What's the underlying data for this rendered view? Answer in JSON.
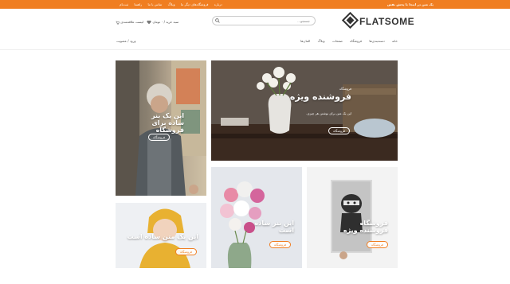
{
  "topbar": {
    "promo": "یک متن در اینجا با پخش نفس",
    "links": [
      "درباره",
      "فروشگاه‌های دیگر ما",
      "وبلاگ",
      "تماس با ما",
      "راهنما",
      "ثبت‌نام"
    ]
  },
  "header": {
    "logo_text": "FLATSOME",
    "search_placeholder": "جستجو...",
    "wishlist_label": "لیست علاقه‌مندی",
    "cart_label": "سبد خرید / ۰ تومان"
  },
  "nav": {
    "items": [
      "خانه",
      "دسته‌بندی‌ها",
      "فروشگاه",
      "صفحات",
      "وبلاگ",
      "المان‌ها"
    ],
    "side": "ورود / عضویت"
  },
  "tiles": {
    "tile1": {
      "title": "این یک بنر ساده برای فروشگاه",
      "button": "فروشگاه"
    },
    "tile2": {
      "kicker": "فروشگاه",
      "title": "فروشنده ویژه",
      "subtitle": "این یک متن برای نوشتن هر چیزی.",
      "button": "فروشگاه"
    },
    "tile3": {
      "title": "این یک متن ساده است",
      "button": "فروشگاه"
    },
    "tile4": {
      "title": "این بنر ساده است",
      "button": "فروشگاه"
    },
    "tile5": {
      "title": "فروشگاه فروشنده ویژه",
      "button": "فروشگاه"
    }
  },
  "colors": {
    "accent": "#f07e21"
  }
}
